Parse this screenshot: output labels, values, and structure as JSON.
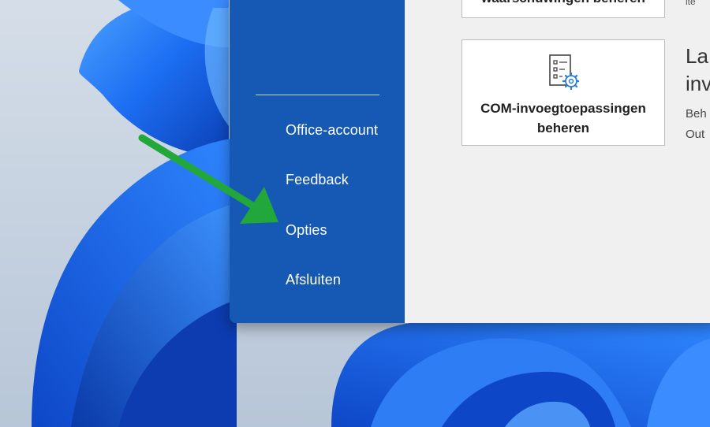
{
  "navigation": {
    "items": [
      {
        "label": "Office-account"
      },
      {
        "label": "Feedback"
      },
      {
        "label": "Opties"
      },
      {
        "label": "Afsluiten"
      }
    ]
  },
  "content": {
    "top_tile_label": "waarschuwingen beheren",
    "top_side_text": "ite",
    "com_tile_label": "COM-invoegtoepassingen beheren",
    "com_side_heading_line1": "La",
    "com_side_heading_line2": "inv",
    "com_side_text_line1": "Beh",
    "com_side_text_line2": "Out"
  },
  "colors": {
    "nav_background": "#1659b5",
    "content_background": "#f0f0f0",
    "annotation_arrow": "#22a83a",
    "icon_accent": "#2b7cd3"
  },
  "icons": {
    "com_tile_icon": "checklist-gear-icon"
  }
}
